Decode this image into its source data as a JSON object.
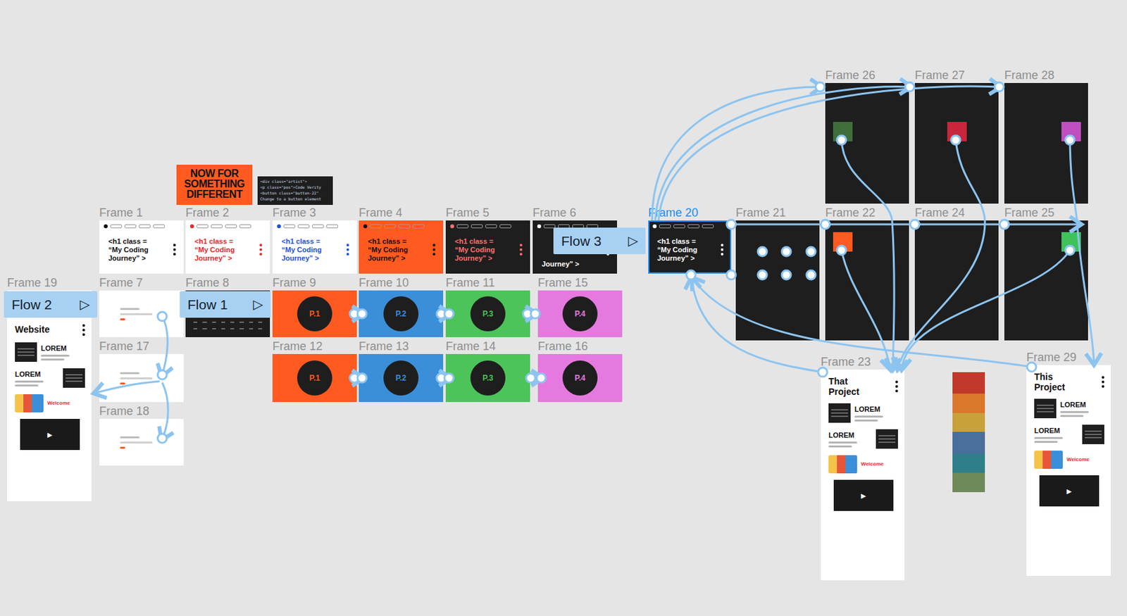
{
  "flows": [
    {
      "label": "Flow 2",
      "icon": "▷"
    },
    {
      "label": "Flow 1",
      "icon": "▷"
    },
    {
      "label": "Flow 3",
      "icon": "▷"
    }
  ],
  "poster": {
    "text": "NOW FOR SOMETHING DIFFERENT"
  },
  "code_card": {
    "lines": [
      "<div class=\"artist\">",
      "<p class=\"pos\">Code Verity",
      "<button class=\"button-22\"",
      "Change to a button element"
    ]
  },
  "frames": [
    {
      "label": "Frame 1",
      "kind": "heading",
      "selected": false,
      "background": "#ffffff",
      "color": "#111111",
      "lines": [
        "<h1 class =",
        "“My Coding",
        "Journey” >"
      ]
    },
    {
      "label": "Frame 2",
      "kind": "heading",
      "selected": false,
      "background": "#ffffff",
      "color": "#e8262b",
      "lines": [
        "<h1 class =",
        "“My Coding",
        "Journey” >"
      ]
    },
    {
      "label": "Frame 3",
      "kind": "heading",
      "selected": false,
      "background": "#ffffff",
      "color": "#1f4fe0",
      "lines": [
        "<h1 class =",
        "“My Coding",
        "Journey” >"
      ]
    },
    {
      "label": "Frame 4",
      "kind": "heading",
      "selected": false,
      "background": "#ff5a1f",
      "color": "#111111",
      "lines": [
        "<h1 class =",
        "“My Coding",
        "Journey” >"
      ]
    },
    {
      "label": "Frame 5",
      "kind": "heading",
      "selected": false,
      "background": "#1e1e1e",
      "color": "#ff6f6f",
      "lines": [
        "<h1 class =",
        "“My Coding",
        "Journey” >"
      ]
    },
    {
      "label": "Frame 6",
      "kind": "heading",
      "selected": false,
      "background": "#1e1e1e",
      "color": "#ffffff",
      "lines": [
        "Journey” >"
      ]
    },
    {
      "label": "Frame 20",
      "kind": "heading",
      "selected": true,
      "background": "#1e1e1e",
      "color": "#ffffff",
      "lines": [
        "<h1 class =",
        "“My Coding",
        "Journey” >"
      ]
    },
    {
      "label": "Frame 7",
      "kind": "mini",
      "selected": false,
      "background": "#ffffff"
    },
    {
      "label": "Frame 8",
      "kind": "code",
      "selected": false,
      "background": "#1e1e1e"
    },
    {
      "label": "Frame 9",
      "kind": "circle",
      "selected": false,
      "background": "#ff5a1f",
      "text": "P.1"
    },
    {
      "label": "Frame 10",
      "kind": "circle",
      "selected": false,
      "background": "#3b8fd9",
      "text": "P.2"
    },
    {
      "label": "Frame 11",
      "kind": "circle",
      "selected": false,
      "background": "#4cc45a",
      "text": "P.3"
    },
    {
      "label": "Frame 15",
      "kind": "circle",
      "selected": false,
      "background": "#e679e0",
      "text": "P.4"
    },
    {
      "label": "Frame 12",
      "kind": "circle",
      "selected": false,
      "background": "#ff5a1f",
      "text": "P.1"
    },
    {
      "label": "Frame 13",
      "kind": "circle",
      "selected": false,
      "background": "#3b8fd9",
      "text": "P.2"
    },
    {
      "label": "Frame 14",
      "kind": "circle",
      "selected": false,
      "background": "#4cc45a",
      "text": "P.3"
    },
    {
      "label": "Frame 16",
      "kind": "circle",
      "selected": false,
      "background": "#e679e0",
      "text": "P.4"
    },
    {
      "label": "Frame 17",
      "kind": "mini",
      "selected": false,
      "background": "#ffffff"
    },
    {
      "label": "Frame 18",
      "kind": "mini",
      "selected": false,
      "background": "#ffffff"
    },
    {
      "label": "Frame 19",
      "kind": "page",
      "selected": false,
      "title": "Website",
      "sections": [
        "LOREM",
        "LOREM"
      ],
      "banner": "Welcome",
      "play": "▶"
    },
    {
      "label": "Frame 21",
      "kind": "dark",
      "selected": false,
      "background": "#1e1e1e"
    },
    {
      "label": "Frame 22",
      "kind": "swatch",
      "selected": false,
      "background": "#1e1e1e",
      "color": "#ff5a1f"
    },
    {
      "label": "Frame 24",
      "kind": "dark",
      "selected": false,
      "background": "#1e1e1e"
    },
    {
      "label": "Frame 25",
      "kind": "swatch",
      "selected": false,
      "background": "#1e1e1e",
      "color": "#3fc25a"
    },
    {
      "label": "Frame 26",
      "kind": "swatch",
      "selected": false,
      "background": "#1e1e1e",
      "color": "#3f6e3a"
    },
    {
      "label": "Frame 27",
      "kind": "swatch",
      "selected": false,
      "background": "#1e1e1e",
      "color": "#c8263a"
    },
    {
      "label": "Frame 28",
      "kind": "swatch",
      "selected": false,
      "background": "#1e1e1e",
      "color": "#c04fc0"
    },
    {
      "label": "Frame 23",
      "kind": "page",
      "selected": false,
      "title": "That Project",
      "sections": [
        "LOREM",
        "LOREM"
      ],
      "banner": "Welcome",
      "play": "▶"
    },
    {
      "label": "Frame 29",
      "kind": "page",
      "selected": false,
      "title": "This Project",
      "sections": [
        "LOREM",
        "LOREM"
      ],
      "banner": "Welcome",
      "play": "▶"
    }
  ]
}
